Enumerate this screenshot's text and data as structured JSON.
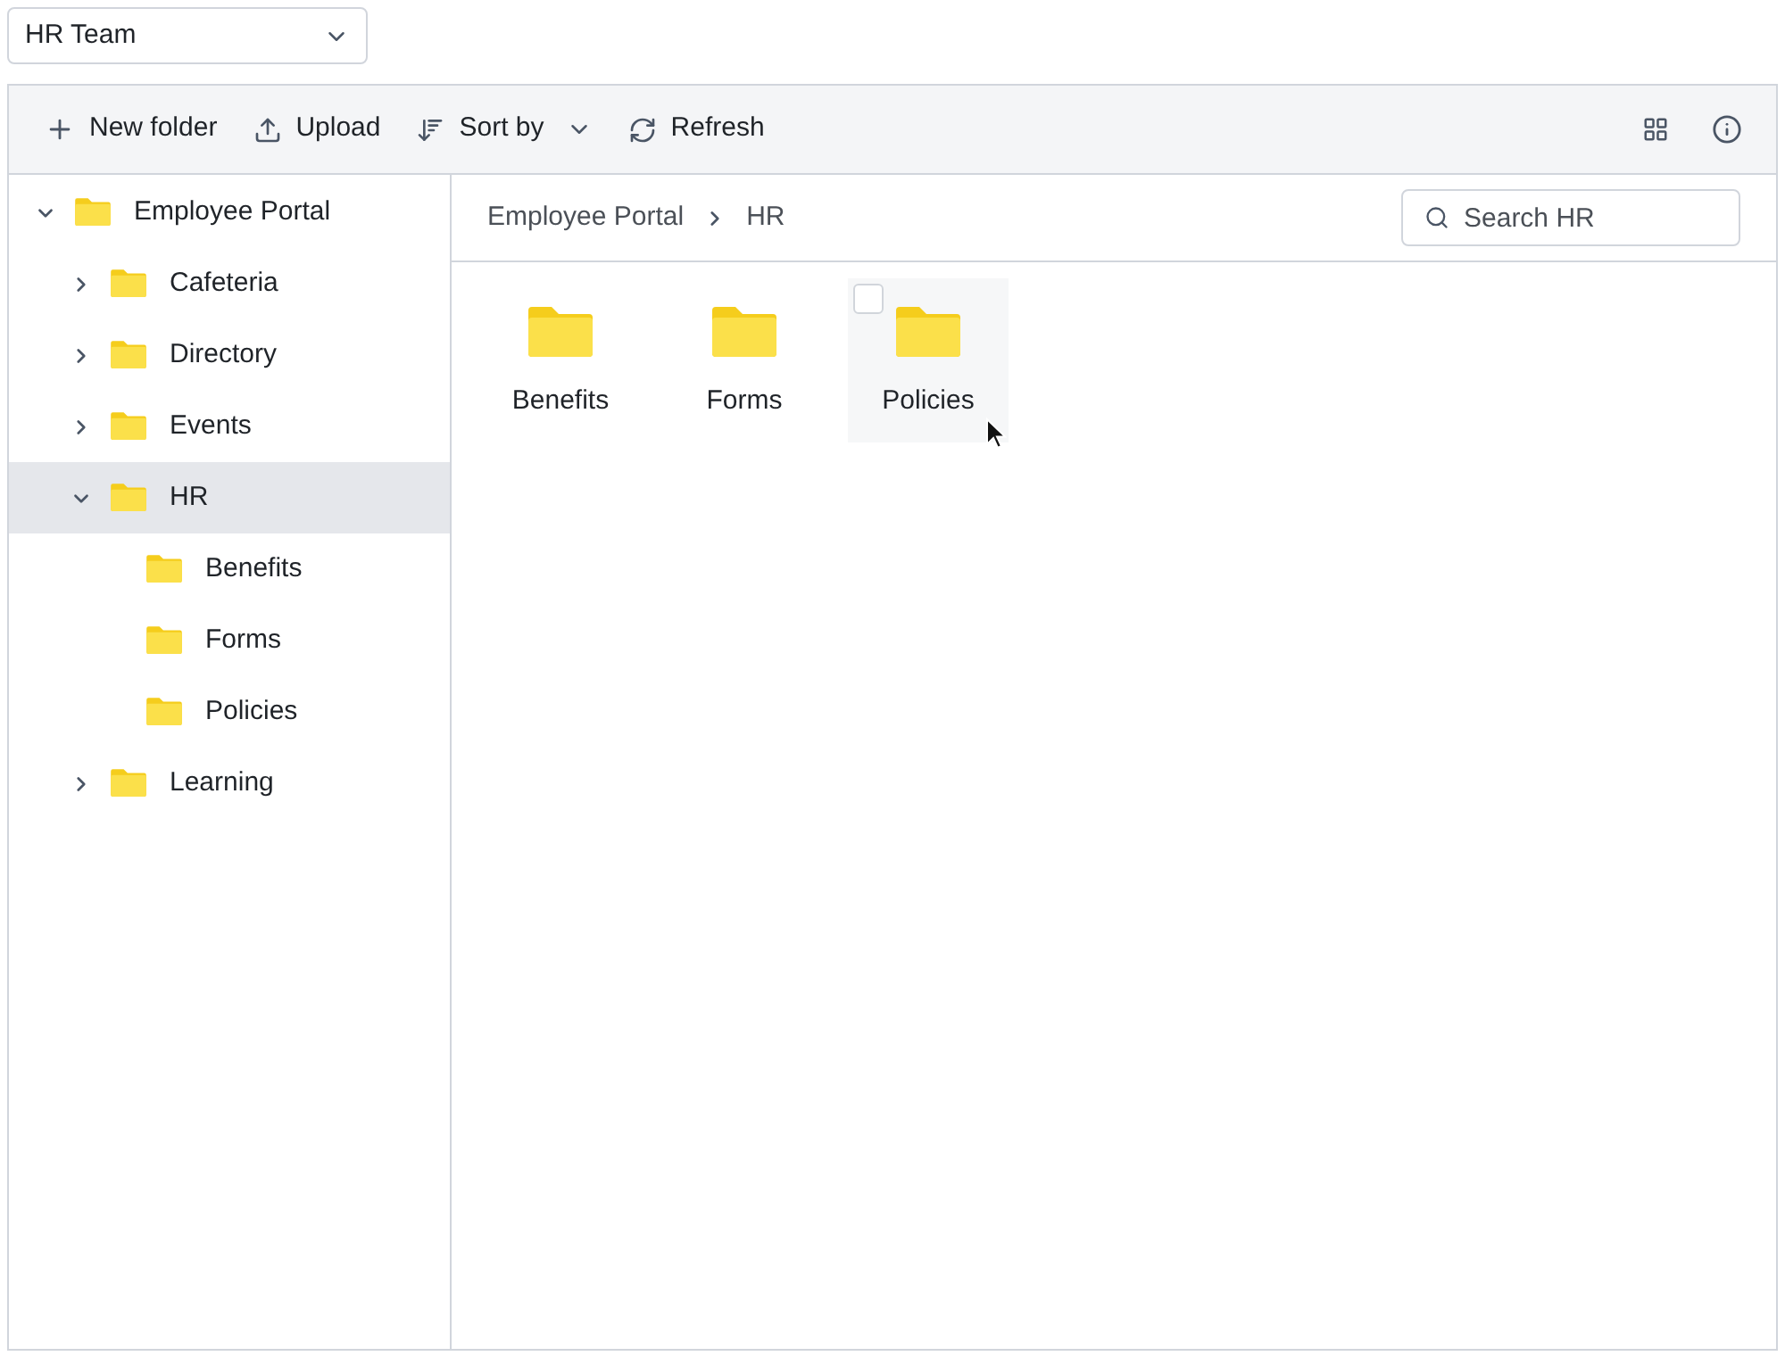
{
  "team_select": {
    "value": "HR Team"
  },
  "toolbar": {
    "buttons": [
      {
        "kind": "new",
        "label": "New folder"
      },
      {
        "kind": "upload",
        "label": "Upload"
      },
      {
        "kind": "sort",
        "label": "Sort by"
      },
      {
        "kind": "refresh",
        "label": "Refresh"
      }
    ]
  },
  "tree": [
    {
      "label": "Employee Portal",
      "expanded": true,
      "selected": false,
      "children": [
        {
          "label": "Cafeteria",
          "expanded": false,
          "selected": false
        },
        {
          "label": "Directory",
          "expanded": false,
          "selected": false
        },
        {
          "label": "Events",
          "expanded": false,
          "selected": false
        },
        {
          "label": "HR",
          "expanded": true,
          "selected": true,
          "children": [
            {
              "label": "Benefits",
              "selected": false
            },
            {
              "label": "Forms",
              "selected": false
            },
            {
              "label": "Policies",
              "selected": false
            }
          ]
        },
        {
          "label": "Learning",
          "expanded": false,
          "selected": false
        }
      ]
    }
  ],
  "breadcrumb": [
    "Employee Portal",
    "HR"
  ],
  "search": {
    "placeholder": "Search HR"
  },
  "items": [
    {
      "label": "Benefits",
      "hovered": false
    },
    {
      "label": "Forms",
      "hovered": false
    },
    {
      "label": "Policies",
      "hovered": true,
      "checked": false
    }
  ]
}
